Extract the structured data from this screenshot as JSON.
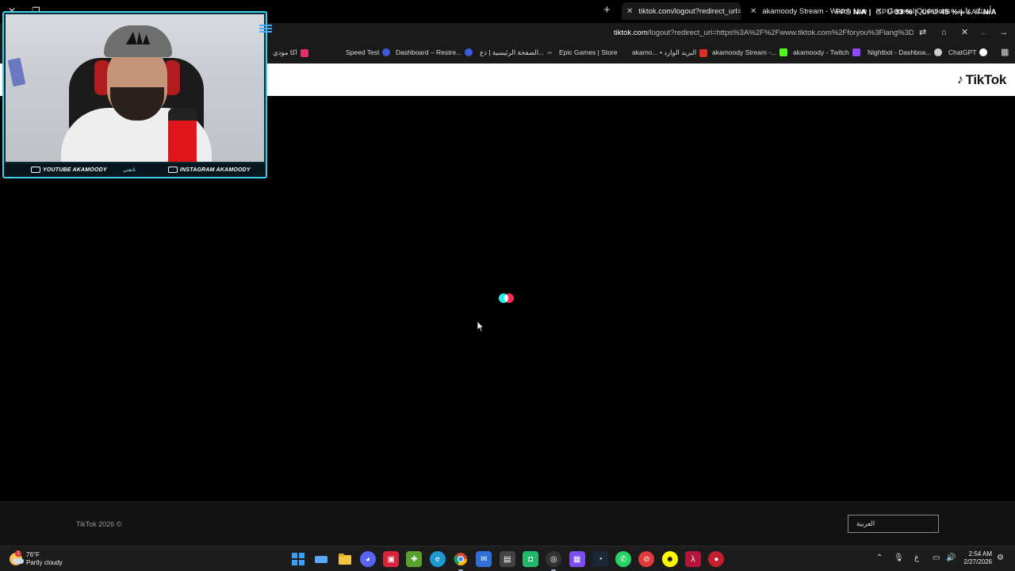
{
  "browser": {
    "tabs": [
      {
        "label": "tiktok.com/logout?redirect_url=",
        "active": true
      },
      {
        "label": "akamoody Stream - Watch Live",
        "active": false
      },
      {
        "label": "General Questions - أسئلة عامة",
        "active": false
      }
    ],
    "perf_overlay": {
      "fps_label": "FPS",
      "fps_value": "N/A",
      "gpu_label": "GPU",
      "gpu_value": "33 %",
      "cpu_label": "CPU",
      "cpu_value": "45 %",
      "lat_label": "LAT",
      "lat_value": "N/A"
    },
    "address": {
      "domain": "tiktok.com",
      "path": "/logout?redirect_url=https%3A%2F%2Fwww.tiktok.com%2Fforyou%3Flang%3Dar"
    },
    "bookmarks": [
      {
        "label": "اكا مودي",
        "color": "#e1306c"
      },
      {
        "label": "Speed Test",
        "color": "#3b5bdb"
      },
      {
        "label": "Dashboard – Restre...",
        "color": "#3b5bdb"
      },
      {
        "label": "الصفحة الرئيسية | دع...",
        "color": "#888888"
      },
      {
        "label": "Epic Games | Store",
        "color": "#dddddd"
      },
      {
        "label": "akamo... • البريد الوارد",
        "color": "#d93025"
      },
      {
        "label": "akamoody Stream -...",
        "color": "#53fc18"
      },
      {
        "label": "akamoody - Twitch",
        "color": "#9146ff"
      },
      {
        "label": "Nightbot - Dashboa...",
        "color": "#cccccc"
      },
      {
        "label": "ChatGPT",
        "color": "#ffffff"
      }
    ]
  },
  "page": {
    "logo_text": "TikTok",
    "copyright": "TikTok 2026 ©",
    "language_selected": "العربية",
    "colors": {
      "loader_cyan": "#25f4ee",
      "loader_red": "#fe2c55"
    }
  },
  "webcam": {
    "youtube_label": "YOUTUBE AKAMOODY",
    "instagram_label": "INSTAGRAM AKAMOODY",
    "center_label": "تابعني"
  },
  "taskbar": {
    "weather_temp": "76°F",
    "weather_desc": "Partly cloudy",
    "weather_badge": "1",
    "time": "2:54 AM",
    "date": "2/27/2026",
    "ime": "ع",
    "apps": [
      {
        "name": "start",
        "color": "#3aa0ff"
      },
      {
        "name": "task-view",
        "color": "#5aa9ff"
      },
      {
        "name": "file-explorer",
        "color": "#f4c542"
      },
      {
        "name": "discord",
        "color": "#5865f2"
      },
      {
        "name": "app-red",
        "color": "#d8243b"
      },
      {
        "name": "minecraft",
        "color": "#5aa02c"
      },
      {
        "name": "edge",
        "color": "#1d9bd1"
      },
      {
        "name": "chrome",
        "color": "#e8e8e8"
      },
      {
        "name": "outlook",
        "color": "#2f6fd6"
      },
      {
        "name": "store",
        "color": "#444444"
      },
      {
        "name": "app-green",
        "color": "#22b86a"
      },
      {
        "name": "obs",
        "color": "#333333"
      },
      {
        "name": "app-grid",
        "color": "#7b4ef0"
      },
      {
        "name": "steam",
        "color": "#1b2838"
      },
      {
        "name": "whatsapp",
        "color": "#25d366"
      },
      {
        "name": "app-antiban",
        "color": "#e03b3b"
      },
      {
        "name": "snapchat",
        "color": "#fffc00"
      },
      {
        "name": "app-lambda",
        "color": "#b3163a"
      },
      {
        "name": "app-record",
        "color": "#c41e2e"
      }
    ]
  }
}
